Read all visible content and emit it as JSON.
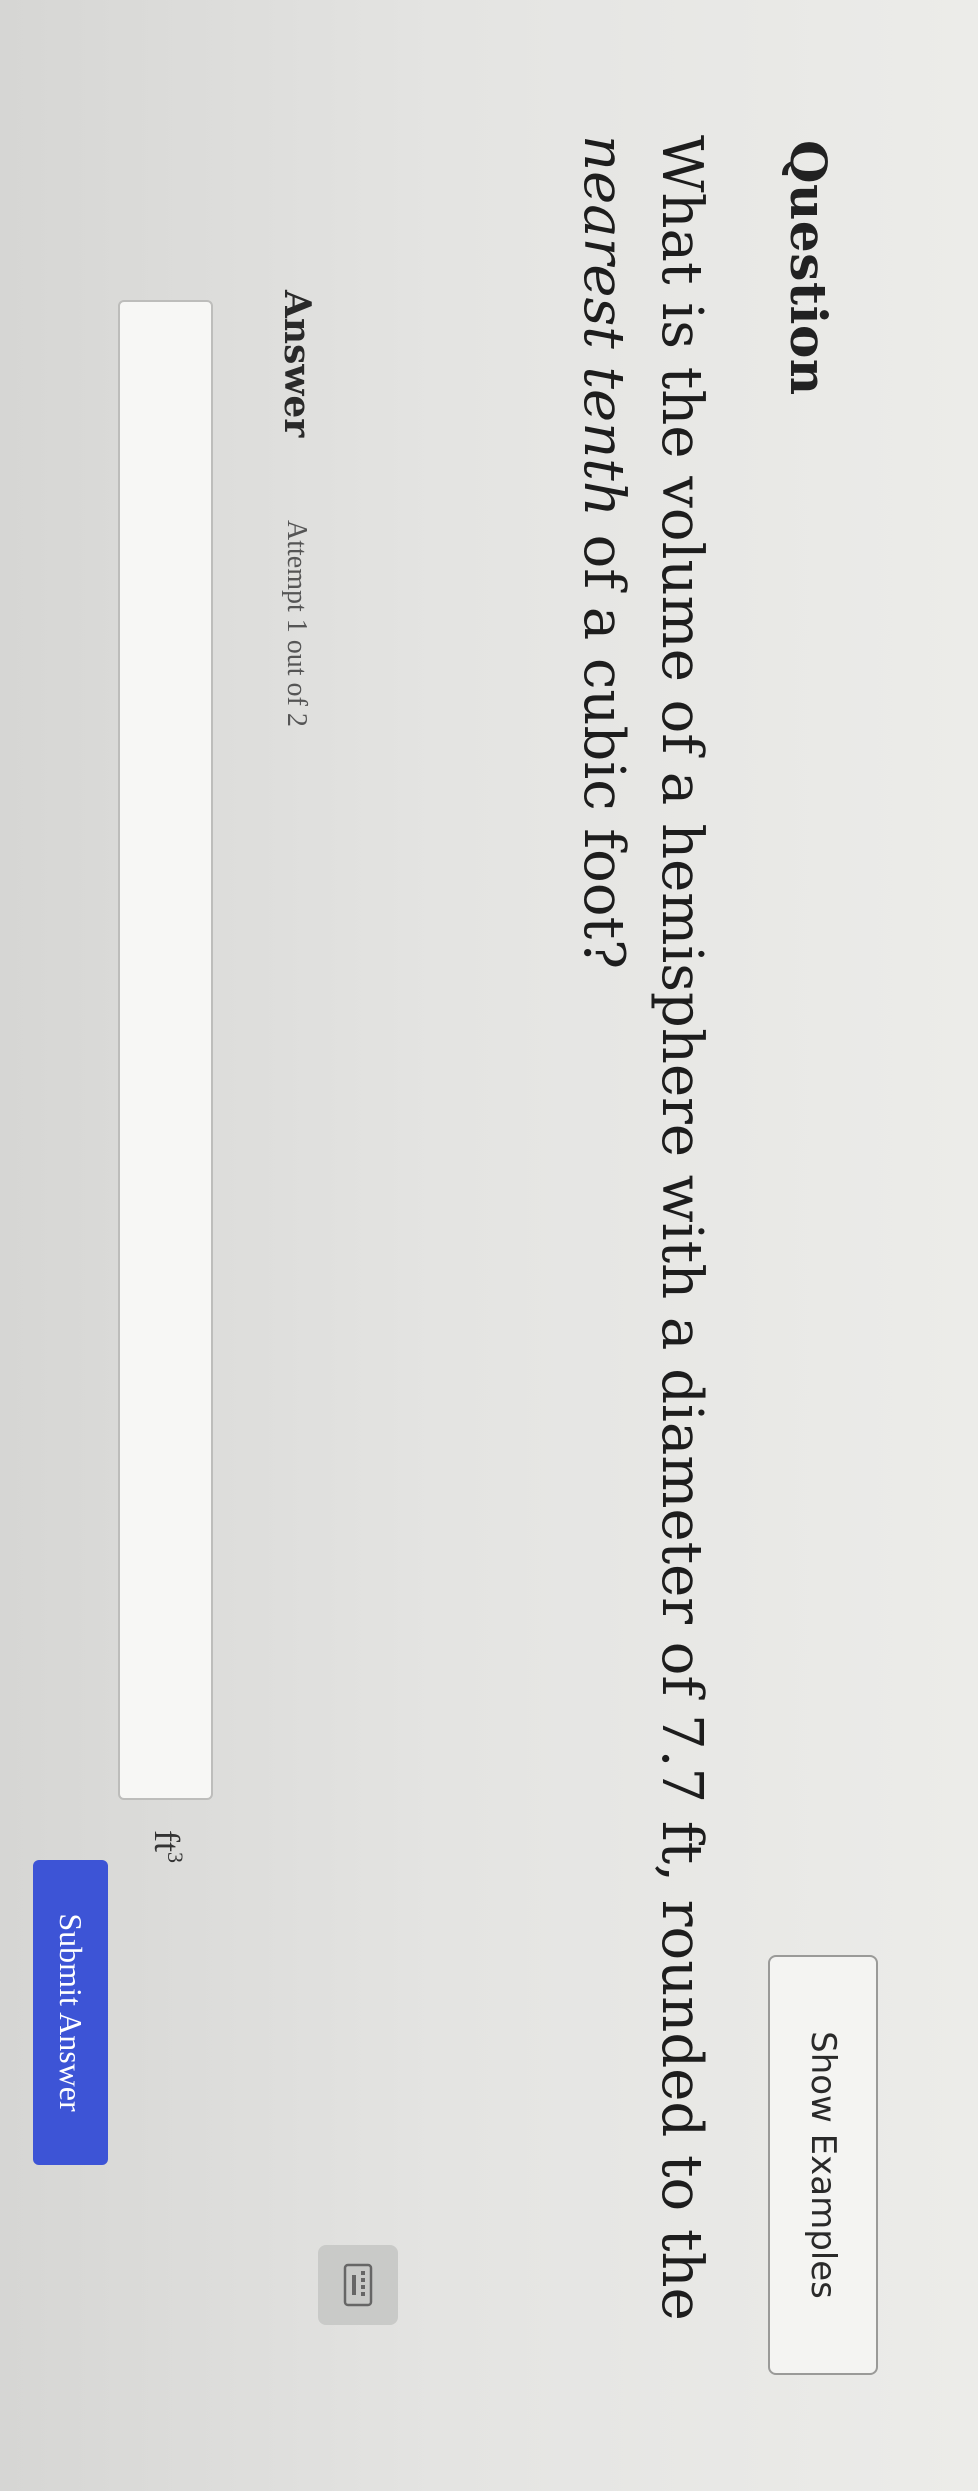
{
  "question": {
    "label": "Question",
    "show_examples_label": "Show Examples",
    "text_part1": "What is the volume of a hemisphere with a diameter of 7.7 ft, rounded to the ",
    "text_italic": "nearest tenth",
    "text_part2": " of a cubic foot?"
  },
  "answer": {
    "label": "Answer",
    "attempt": "Attempt 1 out of 2",
    "input_value": "",
    "unit_base": "ft",
    "unit_exponent": "3",
    "submit_label": "Submit Answer"
  },
  "icons": {
    "keyboard": "keyboard-icon"
  },
  "colors": {
    "submit_button": "#3d54d6",
    "keyboard_button": "#c9cac8"
  }
}
